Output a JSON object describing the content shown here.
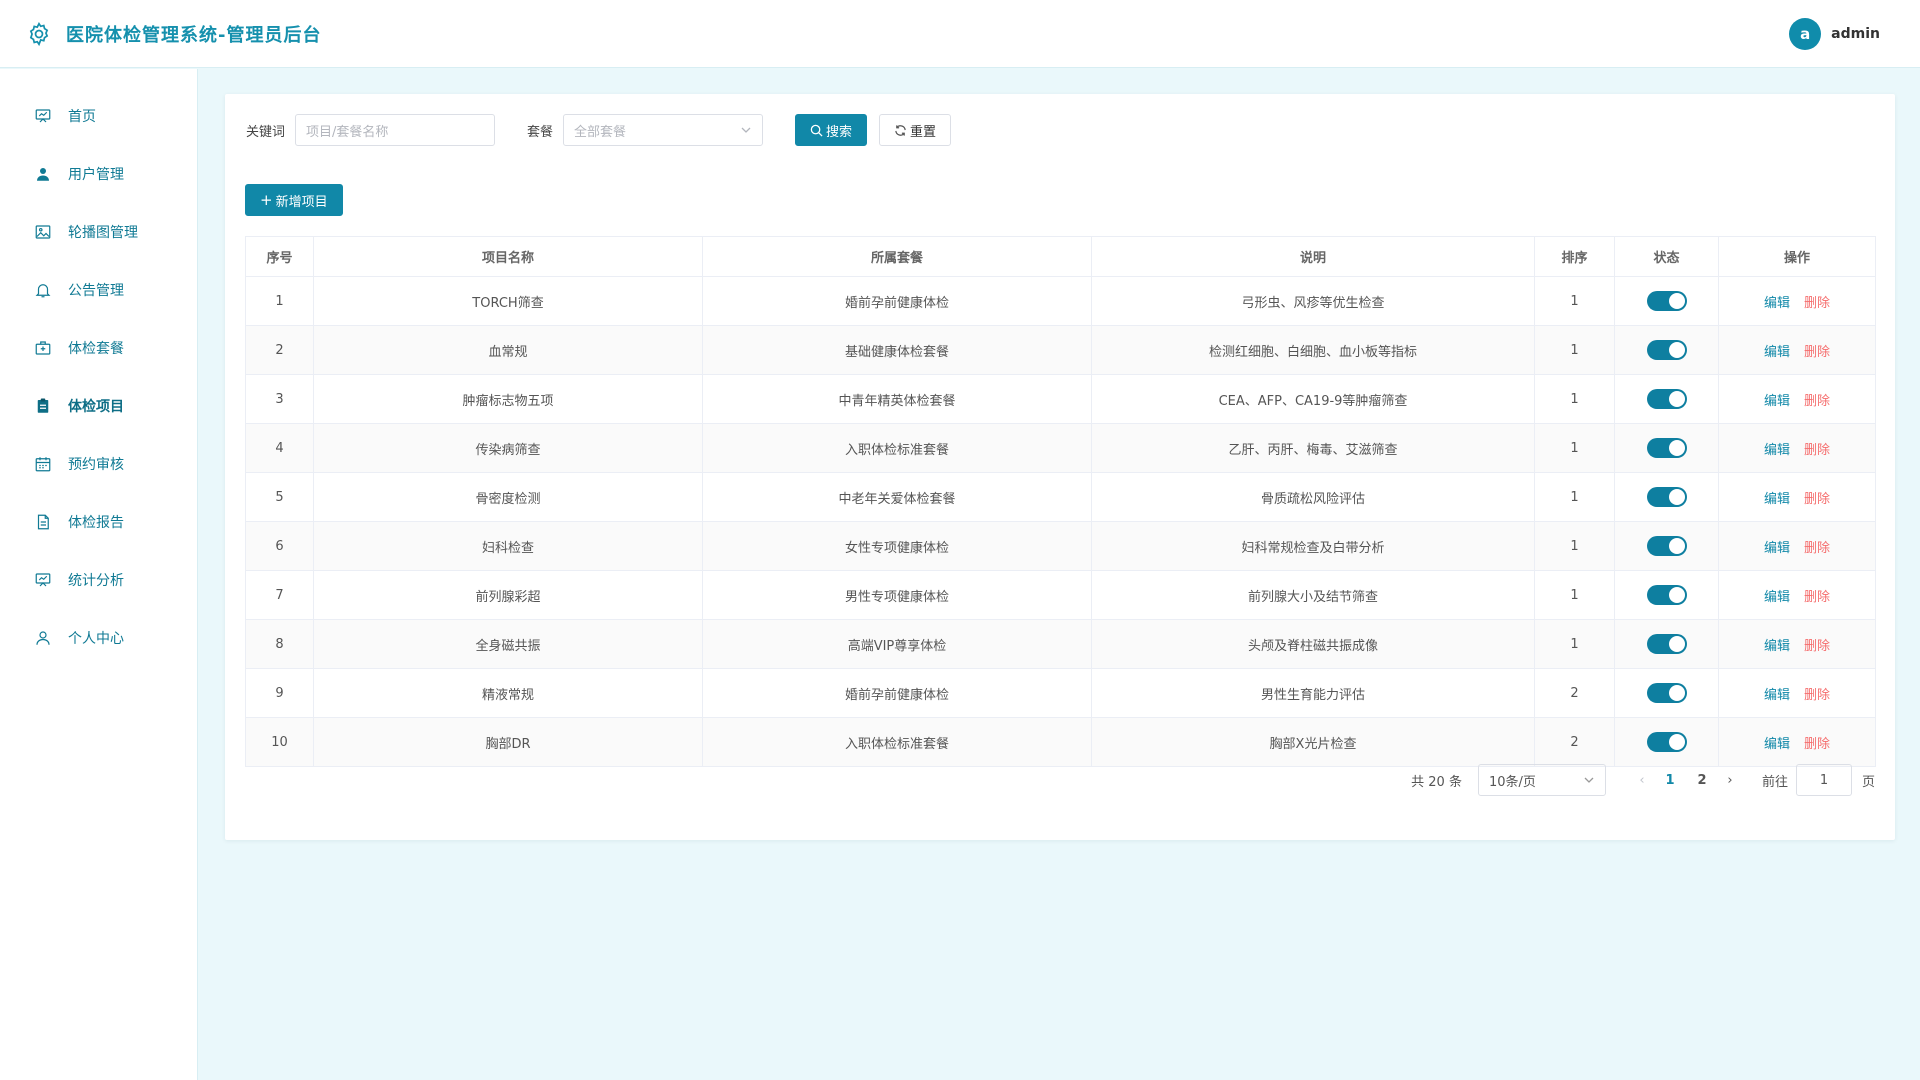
{
  "header": {
    "title": "医院体检管理系统-管理员后台",
    "avatar_letter": "a",
    "username": "admin"
  },
  "sidebar": {
    "items": [
      {
        "label": "首页",
        "icon": "dashboard-icon"
      },
      {
        "label": "用户管理",
        "icon": "user-icon"
      },
      {
        "label": "轮播图管理",
        "icon": "picture-icon"
      },
      {
        "label": "公告管理",
        "icon": "bell-icon"
      },
      {
        "label": "体检套餐",
        "icon": "medical-box-icon"
      },
      {
        "label": "体检项目",
        "icon": "clipboard-icon"
      },
      {
        "label": "预约审核",
        "icon": "calendar-icon"
      },
      {
        "label": "体检报告",
        "icon": "document-icon"
      },
      {
        "label": "统计分析",
        "icon": "chart-icon"
      },
      {
        "label": "个人中心",
        "icon": "person-icon"
      }
    ],
    "active_index": 5
  },
  "search": {
    "keyword_label": "关键词",
    "keyword_placeholder": "项目/套餐名称",
    "package_label": "套餐",
    "package_placeholder": "全部套餐",
    "search_button": "搜索",
    "reset_button": "重置"
  },
  "toolbar": {
    "add_button": "新增项目"
  },
  "table": {
    "columns": [
      "序号",
      "项目名称",
      "所属套餐",
      "说明",
      "排序",
      "状态",
      "操作"
    ],
    "edit_label": "编辑",
    "delete_label": "删除",
    "rows": [
      {
        "no": "1",
        "name": "TORCH筛查",
        "package": "婚前孕前健康体检",
        "desc": "弓形虫、风疹等优生检查",
        "sort": "1",
        "enabled": true
      },
      {
        "no": "2",
        "name": "血常规",
        "package": "基础健康体检套餐",
        "desc": "检测红细胞、白细胞、血小板等指标",
        "sort": "1",
        "enabled": true
      },
      {
        "no": "3",
        "name": "肿瘤标志物五项",
        "package": "中青年精英体检套餐",
        "desc": "CEA、AFP、CA19-9等肿瘤筛查",
        "sort": "1",
        "enabled": true
      },
      {
        "no": "4",
        "name": "传染病筛查",
        "package": "入职体检标准套餐",
        "desc": "乙肝、丙肝、梅毒、艾滋筛查",
        "sort": "1",
        "enabled": true
      },
      {
        "no": "5",
        "name": "骨密度检测",
        "package": "中老年关爱体检套餐",
        "desc": "骨质疏松风险评估",
        "sort": "1",
        "enabled": true
      },
      {
        "no": "6",
        "name": "妇科检查",
        "package": "女性专项健康体检",
        "desc": "妇科常规检查及白带分析",
        "sort": "1",
        "enabled": true
      },
      {
        "no": "7",
        "name": "前列腺彩超",
        "package": "男性专项健康体检",
        "desc": "前列腺大小及结节筛查",
        "sort": "1",
        "enabled": true
      },
      {
        "no": "8",
        "name": "全身磁共振",
        "package": "高端VIP尊享体检",
        "desc": "头颅及脊柱磁共振成像",
        "sort": "1",
        "enabled": true
      },
      {
        "no": "9",
        "name": "精液常规",
        "package": "婚前孕前健康体检",
        "desc": "男性生育能力评估",
        "sort": "2",
        "enabled": true
      },
      {
        "no": "10",
        "name": "胸部DR",
        "package": "入职体检标准套餐",
        "desc": "胸部X光片检查",
        "sort": "2",
        "enabled": true
      }
    ]
  },
  "pagination": {
    "total_text": "共 20 条",
    "page_size": "10条/页",
    "pages": [
      "1",
      "2"
    ],
    "current": "1",
    "goto_label": "前往",
    "goto_value": "1",
    "unit_label": "页"
  },
  "colors": {
    "primary": "#1188a8",
    "danger": "#f56c6c",
    "background": "#eaf8fb"
  }
}
